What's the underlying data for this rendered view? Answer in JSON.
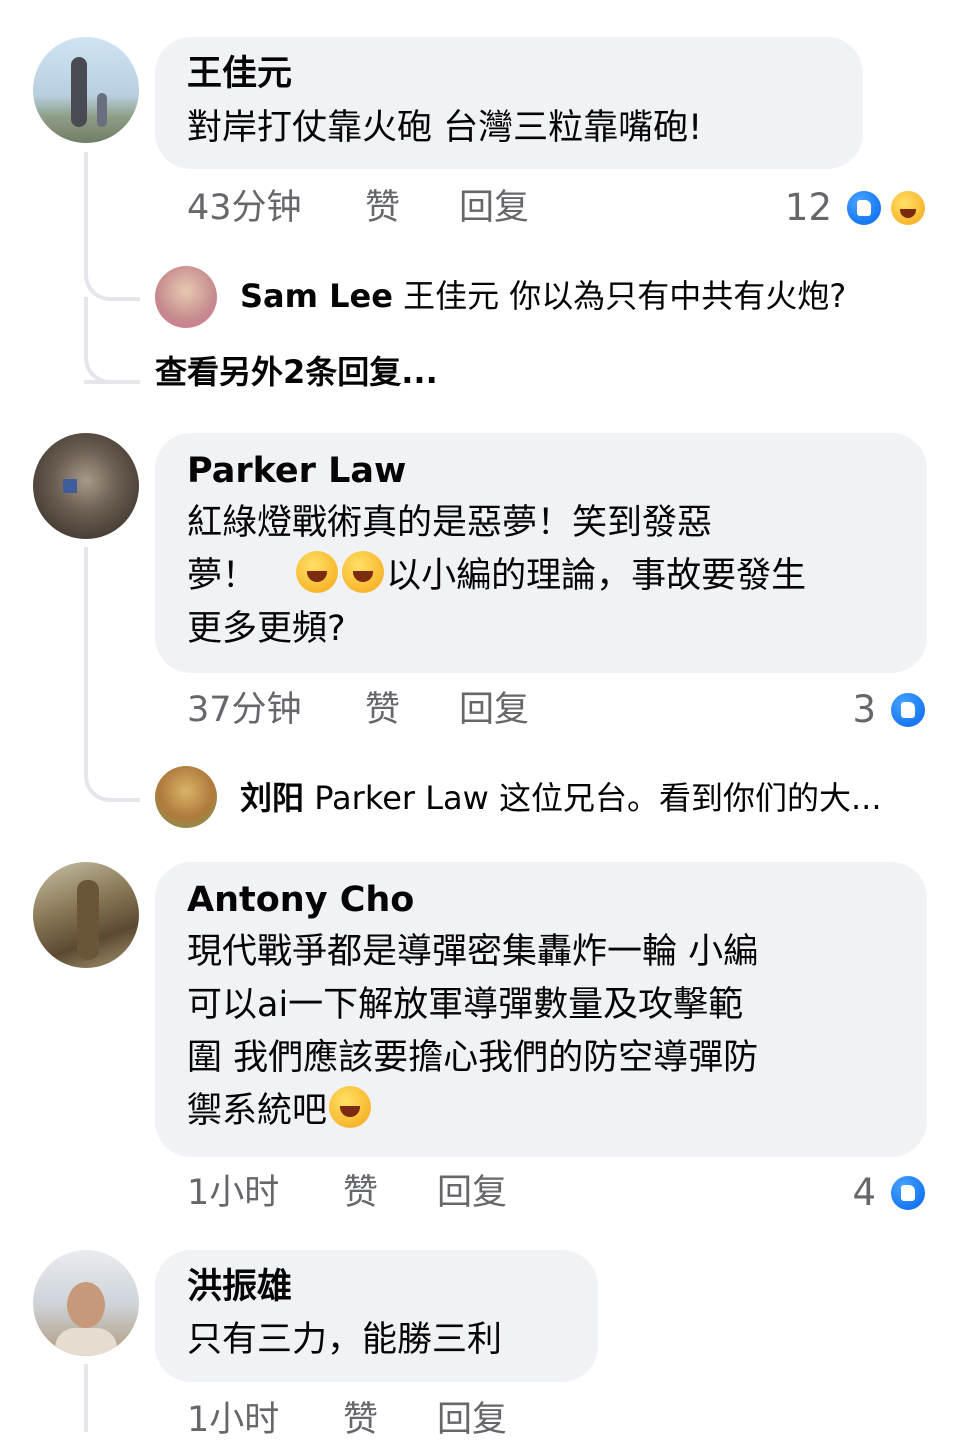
{
  "colors": {
    "bubble": "#f0f2f5",
    "meta_text": "#65676b",
    "like_blue": "#1877f2",
    "haha_yellow": "#f7b125"
  },
  "comments": [
    {
      "author": "王佳元",
      "text_lines": [
        "對岸打仗靠火砲 台灣三粒靠嘴砲!"
      ],
      "time": "43分钟",
      "like_label": "赞",
      "reply_label": "回复",
      "reaction_count": "12",
      "reactions": [
        "like-icon",
        "haha-icon"
      ],
      "reply": {
        "author": "Sam Lee",
        "text": "王佳元 你以為只有中共有火炮?"
      },
      "more_replies": "查看另外2条回复..."
    },
    {
      "author": "Parker Law",
      "text_lines": [
        "紅綠燈戰術真的是惡夢！笑到發惡",
        "夢！",
        "以小編的理論，事故要發生",
        "更多更頻?"
      ],
      "time": "37分钟",
      "like_label": "赞",
      "reply_label": "回复",
      "reaction_count": "3",
      "reactions": [
        "like-icon"
      ],
      "reply": {
        "author": "刘阳",
        "text": "Parker Law 这位兄台。看到你们的大..."
      }
    },
    {
      "author": "Antony Cho",
      "text_lines": [
        "現代戰爭都是導彈密集轟炸一輪 小編",
        "可以ai一下解放軍導彈數量及攻擊範",
        "圍 我們應該要擔心我們的防空導彈防",
        "禦系統吧"
      ],
      "time": "1小时",
      "like_label": "赞",
      "reply_label": "回复",
      "reaction_count": "4",
      "reactions": [
        "like-icon"
      ]
    },
    {
      "author": "洪振雄",
      "text_lines": [
        "只有三力，能勝三利"
      ],
      "time": "1小时",
      "like_label": "赞",
      "reply_label": "回复"
    }
  ]
}
